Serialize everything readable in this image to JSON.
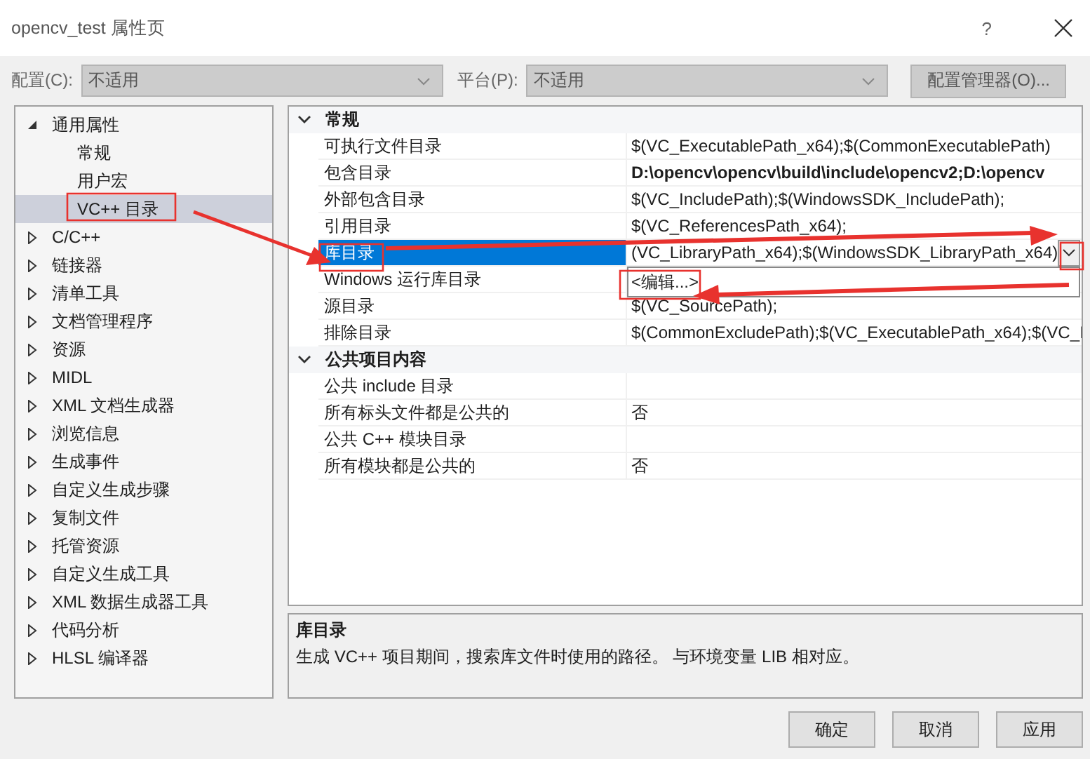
{
  "window": {
    "title": "opencv_test 属性页",
    "help": "?"
  },
  "toolbar": {
    "config_label": "配置(C):",
    "config_value": "不适用",
    "platform_label": "平台(P):",
    "platform_value": "不适用",
    "manager_button": "配置管理器(O)..."
  },
  "tree": [
    {
      "label": "通用属性",
      "expanded": true,
      "selected": false,
      "children": [
        {
          "label": "常规",
          "selected": false
        },
        {
          "label": "用户宏",
          "selected": false
        },
        {
          "label": "VC++ 目录",
          "selected": true
        }
      ]
    },
    {
      "label": "C/C++",
      "expanded": false,
      "selected": false
    },
    {
      "label": "链接器",
      "expanded": false,
      "selected": false
    },
    {
      "label": "清单工具",
      "expanded": false,
      "selected": false
    },
    {
      "label": "文档管理程序",
      "expanded": false,
      "selected": false
    },
    {
      "label": "资源",
      "expanded": false,
      "selected": false
    },
    {
      "label": "MIDL",
      "expanded": false,
      "selected": false
    },
    {
      "label": "XML 文档生成器",
      "expanded": false,
      "selected": false
    },
    {
      "label": "浏览信息",
      "expanded": false,
      "selected": false
    },
    {
      "label": "生成事件",
      "expanded": false,
      "selected": false
    },
    {
      "label": "自定义生成步骤",
      "expanded": false,
      "selected": false
    },
    {
      "label": "复制文件",
      "expanded": false,
      "selected": false
    },
    {
      "label": "托管资源",
      "expanded": false,
      "selected": false
    },
    {
      "label": "自定义生成工具",
      "expanded": false,
      "selected": false
    },
    {
      "label": "XML 数据生成器工具",
      "expanded": false,
      "selected": false
    },
    {
      "label": "代码分析",
      "expanded": false,
      "selected": false
    },
    {
      "label": "HLSL 编译器",
      "expanded": false,
      "selected": false
    }
  ],
  "grid": {
    "categories": [
      {
        "title": "常规",
        "expanded": true,
        "rows": [
          {
            "name": "可执行文件目录",
            "value": "$(VC_ExecutablePath_x64);$(CommonExecutablePath)",
            "selected": false
          },
          {
            "name": "包含目录",
            "value": "D:\\opencv\\opencv\\build\\include\\opencv2;D:\\opencv",
            "bold": true,
            "selected": false
          },
          {
            "name": "外部包含目录",
            "value": "$(VC_IncludePath);$(WindowsSDK_IncludePath);",
            "selected": false
          },
          {
            "name": "引用目录",
            "value": "$(VC_ReferencesPath_x64);",
            "selected": false
          },
          {
            "name": "库目录",
            "value": "(VC_LibraryPath_x64);$(WindowsSDK_LibraryPath_x64)",
            "selected": true
          },
          {
            "name": "Windows 运行库目录",
            "value": "",
            "selected": false
          },
          {
            "name": "源目录",
            "value": "$(VC_SourcePath);",
            "selected": false
          },
          {
            "name": "排除目录",
            "value": "$(CommonExcludePath);$(VC_ExecutablePath_x64);$(VC_I",
            "selected": false
          }
        ]
      },
      {
        "title": "公共项目内容",
        "expanded": true,
        "rows": [
          {
            "name": "公共 include 目录",
            "value": "",
            "selected": false
          },
          {
            "name": "所有标头文件都是公共的",
            "value": "否",
            "selected": false
          },
          {
            "name": "公共 C++ 模块目录",
            "value": "",
            "selected": false
          },
          {
            "name": "所有模块都是公共的",
            "value": "否",
            "selected": false
          }
        ]
      }
    ],
    "dropdown_items": [
      "<编辑...>"
    ]
  },
  "description": {
    "title": "库目录",
    "text": "生成 VC++ 项目期间，搜索库文件时使用的路径。 与环境变量 LIB 相对应。"
  },
  "buttons": [
    "确定",
    "取消",
    "应用"
  ]
}
